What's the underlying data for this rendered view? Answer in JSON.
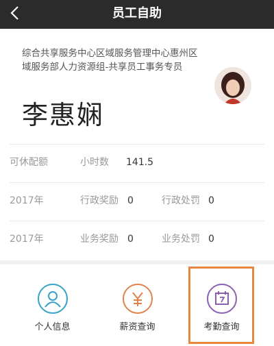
{
  "header": {
    "title": "员工自助",
    "back_icon": "chevron-left-icon"
  },
  "profile": {
    "department": "综合共享服务中心区域服务管理中心惠州区域服务部人力资源组-共享员工事务专员",
    "name": "李惠娴",
    "avatar_icon": "user-avatar-photo"
  },
  "rows": [
    {
      "label": "可休配额",
      "sub_label": "小时数",
      "value": "141.5"
    },
    {
      "label": "2017年",
      "sub_label": "行政奖励",
      "value": "0",
      "sub_label2": "行政处罚",
      "value2": "0"
    },
    {
      "label": "2017年",
      "sub_label": "业务奖励",
      "value": "0",
      "sub_label2": "业务处罚",
      "value2": "0"
    }
  ],
  "tabs": [
    {
      "label": "个人信息",
      "icon": "person-icon",
      "color": "#35a0c8"
    },
    {
      "label": "薪资查询",
      "icon": "yuan-icon",
      "color": "#e0824a"
    },
    {
      "label": "考勤查询",
      "icon": "calendar-icon",
      "color": "#8a5fb0"
    }
  ],
  "colors": {
    "header_bg": "#2b2b2b",
    "highlight": "#e8873d"
  }
}
